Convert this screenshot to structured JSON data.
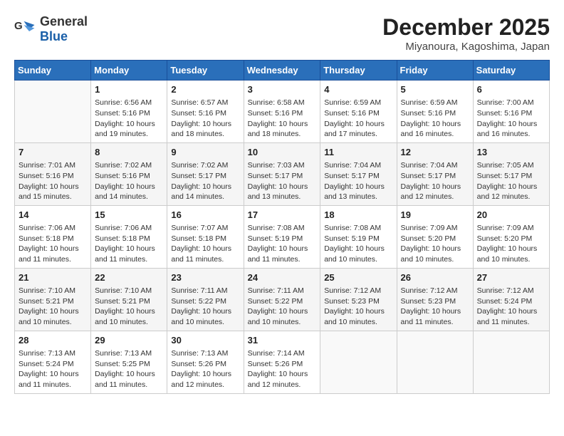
{
  "header": {
    "logo_general": "General",
    "logo_blue": "Blue",
    "month_title": "December 2025",
    "location": "Miyanoura, Kagoshima, Japan"
  },
  "weekdays": [
    "Sunday",
    "Monday",
    "Tuesday",
    "Wednesday",
    "Thursday",
    "Friday",
    "Saturday"
  ],
  "weeks": [
    [
      {
        "day": "",
        "info": ""
      },
      {
        "day": "1",
        "info": "Sunrise: 6:56 AM\nSunset: 5:16 PM\nDaylight: 10 hours\nand 19 minutes."
      },
      {
        "day": "2",
        "info": "Sunrise: 6:57 AM\nSunset: 5:16 PM\nDaylight: 10 hours\nand 18 minutes."
      },
      {
        "day": "3",
        "info": "Sunrise: 6:58 AM\nSunset: 5:16 PM\nDaylight: 10 hours\nand 18 minutes."
      },
      {
        "day": "4",
        "info": "Sunrise: 6:59 AM\nSunset: 5:16 PM\nDaylight: 10 hours\nand 17 minutes."
      },
      {
        "day": "5",
        "info": "Sunrise: 6:59 AM\nSunset: 5:16 PM\nDaylight: 10 hours\nand 16 minutes."
      },
      {
        "day": "6",
        "info": "Sunrise: 7:00 AM\nSunset: 5:16 PM\nDaylight: 10 hours\nand 16 minutes."
      }
    ],
    [
      {
        "day": "7",
        "info": "Sunrise: 7:01 AM\nSunset: 5:16 PM\nDaylight: 10 hours\nand 15 minutes."
      },
      {
        "day": "8",
        "info": "Sunrise: 7:02 AM\nSunset: 5:16 PM\nDaylight: 10 hours\nand 14 minutes."
      },
      {
        "day": "9",
        "info": "Sunrise: 7:02 AM\nSunset: 5:17 PM\nDaylight: 10 hours\nand 14 minutes."
      },
      {
        "day": "10",
        "info": "Sunrise: 7:03 AM\nSunset: 5:17 PM\nDaylight: 10 hours\nand 13 minutes."
      },
      {
        "day": "11",
        "info": "Sunrise: 7:04 AM\nSunset: 5:17 PM\nDaylight: 10 hours\nand 13 minutes."
      },
      {
        "day": "12",
        "info": "Sunrise: 7:04 AM\nSunset: 5:17 PM\nDaylight: 10 hours\nand 12 minutes."
      },
      {
        "day": "13",
        "info": "Sunrise: 7:05 AM\nSunset: 5:17 PM\nDaylight: 10 hours\nand 12 minutes."
      }
    ],
    [
      {
        "day": "14",
        "info": "Sunrise: 7:06 AM\nSunset: 5:18 PM\nDaylight: 10 hours\nand 11 minutes."
      },
      {
        "day": "15",
        "info": "Sunrise: 7:06 AM\nSunset: 5:18 PM\nDaylight: 10 hours\nand 11 minutes."
      },
      {
        "day": "16",
        "info": "Sunrise: 7:07 AM\nSunset: 5:18 PM\nDaylight: 10 hours\nand 11 minutes."
      },
      {
        "day": "17",
        "info": "Sunrise: 7:08 AM\nSunset: 5:19 PM\nDaylight: 10 hours\nand 11 minutes."
      },
      {
        "day": "18",
        "info": "Sunrise: 7:08 AM\nSunset: 5:19 PM\nDaylight: 10 hours\nand 10 minutes."
      },
      {
        "day": "19",
        "info": "Sunrise: 7:09 AM\nSunset: 5:20 PM\nDaylight: 10 hours\nand 10 minutes."
      },
      {
        "day": "20",
        "info": "Sunrise: 7:09 AM\nSunset: 5:20 PM\nDaylight: 10 hours\nand 10 minutes."
      }
    ],
    [
      {
        "day": "21",
        "info": "Sunrise: 7:10 AM\nSunset: 5:21 PM\nDaylight: 10 hours\nand 10 minutes."
      },
      {
        "day": "22",
        "info": "Sunrise: 7:10 AM\nSunset: 5:21 PM\nDaylight: 10 hours\nand 10 minutes."
      },
      {
        "day": "23",
        "info": "Sunrise: 7:11 AM\nSunset: 5:22 PM\nDaylight: 10 hours\nand 10 minutes."
      },
      {
        "day": "24",
        "info": "Sunrise: 7:11 AM\nSunset: 5:22 PM\nDaylight: 10 hours\nand 10 minutes."
      },
      {
        "day": "25",
        "info": "Sunrise: 7:12 AM\nSunset: 5:23 PM\nDaylight: 10 hours\nand 10 minutes."
      },
      {
        "day": "26",
        "info": "Sunrise: 7:12 AM\nSunset: 5:23 PM\nDaylight: 10 hours\nand 11 minutes."
      },
      {
        "day": "27",
        "info": "Sunrise: 7:12 AM\nSunset: 5:24 PM\nDaylight: 10 hours\nand 11 minutes."
      }
    ],
    [
      {
        "day": "28",
        "info": "Sunrise: 7:13 AM\nSunset: 5:24 PM\nDaylight: 10 hours\nand 11 minutes."
      },
      {
        "day": "29",
        "info": "Sunrise: 7:13 AM\nSunset: 5:25 PM\nDaylight: 10 hours\nand 11 minutes."
      },
      {
        "day": "30",
        "info": "Sunrise: 7:13 AM\nSunset: 5:26 PM\nDaylight: 10 hours\nand 12 minutes."
      },
      {
        "day": "31",
        "info": "Sunrise: 7:14 AM\nSunset: 5:26 PM\nDaylight: 10 hours\nand 12 minutes."
      },
      {
        "day": "",
        "info": ""
      },
      {
        "day": "",
        "info": ""
      },
      {
        "day": "",
        "info": ""
      }
    ]
  ]
}
